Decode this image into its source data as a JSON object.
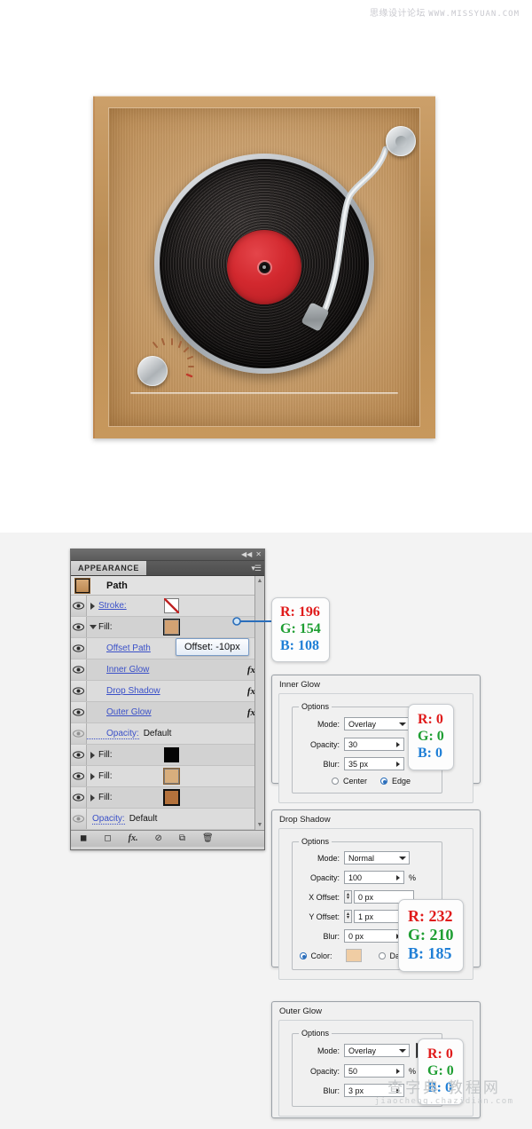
{
  "watermarks": {
    "top_cn": "思缘设计论坛",
    "top_url": "WWW.MISSYUAN.COM",
    "bottom_cn": "查字典 教程网",
    "bottom_url": "jiaocheng.chazidian.com"
  },
  "illustration": {
    "name": "vintage-turntable-icon",
    "record_label_color": "#d2282e",
    "wood_color": "#c49258",
    "record_color": "#1f1b1a"
  },
  "panel": {
    "tab_label": "APPEARANCE",
    "collapse_icon": "◀◀",
    "close_icon": "✕",
    "menu_icon": "▾☰",
    "thumb_row": {
      "label": "Path"
    },
    "rows": [
      {
        "name": "stroke",
        "label": "Stroke:",
        "style": "link",
        "swatch": "none",
        "tri": "closed",
        "eye": "on"
      },
      {
        "name": "fill",
        "label": "Fill:",
        "style": "plain",
        "swatch": "fill-tan",
        "tri": "open",
        "eye": "on"
      },
      {
        "name": "offset-path",
        "label": "Offset Path",
        "style": "link",
        "indent": true,
        "eye": "on"
      },
      {
        "name": "inner-glow",
        "label": "Inner Glow",
        "style": "link",
        "indent": true,
        "fx": "fx",
        "eye": "on"
      },
      {
        "name": "drop-shadow",
        "label": "Drop Shadow",
        "style": "link",
        "indent": true,
        "fx": "fx",
        "eye": "on"
      },
      {
        "name": "outer-glow",
        "label": "Outer Glow",
        "style": "link",
        "indent": true,
        "fx": "fx",
        "eye": "on"
      },
      {
        "name": "opacity-fill",
        "label": "Opacity:",
        "style": "dotted",
        "value": "Default",
        "indent": true,
        "eye": "dim"
      },
      {
        "name": "fill-black",
        "label": "Fill:",
        "style": "plain",
        "swatch": "fill-black",
        "tri": "closed",
        "eye": "on"
      },
      {
        "name": "fill-tan2",
        "label": "Fill:",
        "style": "plain",
        "swatch": "fill-tan2",
        "tri": "closed",
        "eye": "on"
      },
      {
        "name": "fill-brown",
        "label": "Fill:",
        "style": "plain",
        "swatch": "fill-brown",
        "tri": "closed",
        "eye": "on"
      },
      {
        "name": "opacity-object",
        "label": "Opacity:",
        "style": "dotted",
        "value": "Default",
        "eye": "dim"
      }
    ],
    "footer_icons": [
      "add-new-stroke",
      "add-new-fill",
      "add-new-effect",
      "clear-appearance",
      "duplicate-item",
      "delete-item"
    ]
  },
  "tooltip": {
    "offset_label": "Offset: -10px"
  },
  "callouts": {
    "fill_color": {
      "r": "R: 196",
      "g": "G: 154",
      "b": "B: 108"
    },
    "inner_glow": {
      "r": "R: 0",
      "g": "G: 0",
      "b": "B: 0"
    },
    "drop_shadow": {
      "r": "R: 232",
      "g": "G: 210",
      "b": "B: 185"
    },
    "outer_glow": {
      "r": "R: 0",
      "g": "G: 0",
      "b": "B: 0"
    }
  },
  "dialogs": {
    "inner_glow": {
      "title": "Inner Glow",
      "options_legend": "Options",
      "mode_label": "Mode:",
      "mode_value": "Overlay",
      "color_swatch": "#0a0a0a",
      "opacity_label": "Opacity:",
      "opacity_value": "30",
      "opacity_unit": "%",
      "blur_label": "Blur:",
      "blur_value": "35 px",
      "center_label": "Center",
      "edge_label": "Edge",
      "selected_origin": "Edge"
    },
    "drop_shadow": {
      "title": "Drop Shadow",
      "options_legend": "Options",
      "mode_label": "Mode:",
      "mode_value": "Normal",
      "opacity_label": "Opacity:",
      "opacity_value": "100",
      "opacity_unit": "%",
      "x_offset_label": "X Offset:",
      "x_offset_value": "0 px",
      "y_offset_label": "Y Offset:",
      "y_offset_value": "1 px",
      "blur_label": "Blur:",
      "blur_value": "0 px",
      "color_label": "Color:",
      "color_swatch": "#f0cda4",
      "darkness_label": "Darkness:",
      "selected_mode": "Color"
    },
    "outer_glow": {
      "title": "Outer Glow",
      "options_legend": "Options",
      "mode_label": "Mode:",
      "mode_value": "Overlay",
      "color_swatch": "#0a0a0a",
      "opacity_label": "Opacity:",
      "opacity_value": "50",
      "opacity_unit": "%",
      "blur_label": "Blur:",
      "blur_value": "3 px"
    }
  }
}
